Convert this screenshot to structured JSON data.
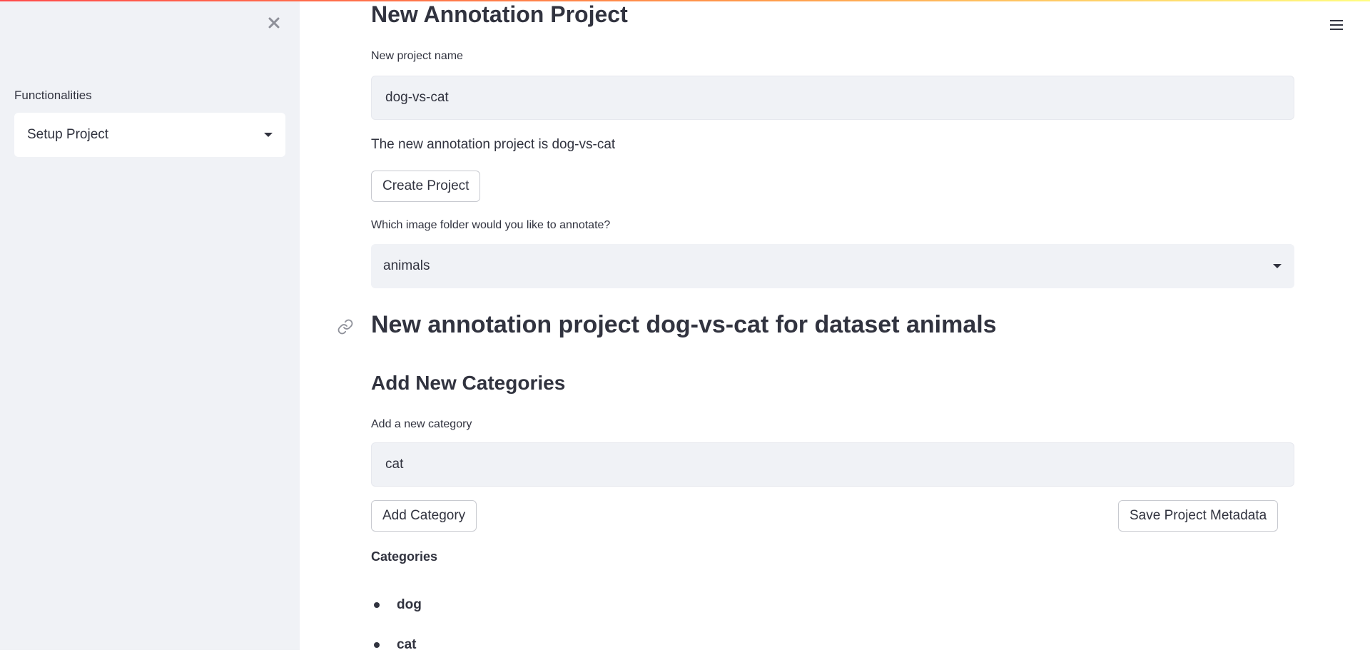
{
  "sidebar": {
    "label": "Functionalities",
    "select_value": "Setup Project"
  },
  "main": {
    "title": "New Annotation Project",
    "project_name_label": "New project name",
    "project_name_value": "dog-vs-cat",
    "info_text": "The new annotation project is dog-vs-cat",
    "create_button": "Create Project",
    "folder_label": "Which image folder would you like to annotate?",
    "folder_value": "animals",
    "project_heading": "New annotation project dog-vs-cat for dataset animals",
    "categories_heading": "Add New Categories",
    "category_label": "Add a new category",
    "category_value": "cat",
    "add_category_button": "Add Category",
    "save_metadata_button": "Save Project Metadata",
    "categories_title": "Categories",
    "categories": [
      "dog",
      "cat"
    ]
  },
  "icons": {
    "close": "close-icon",
    "menu": "hamburger-menu-icon",
    "link": "link-icon",
    "dropdown": "chevron-down-icon"
  },
  "colors": {
    "sidebar_bg": "#f0f2f6",
    "text": "#31333f",
    "input_bg": "#f0f2f6",
    "accent_gradient_start": "#ff4b4b",
    "accent_gradient_end": "#fffd80"
  }
}
